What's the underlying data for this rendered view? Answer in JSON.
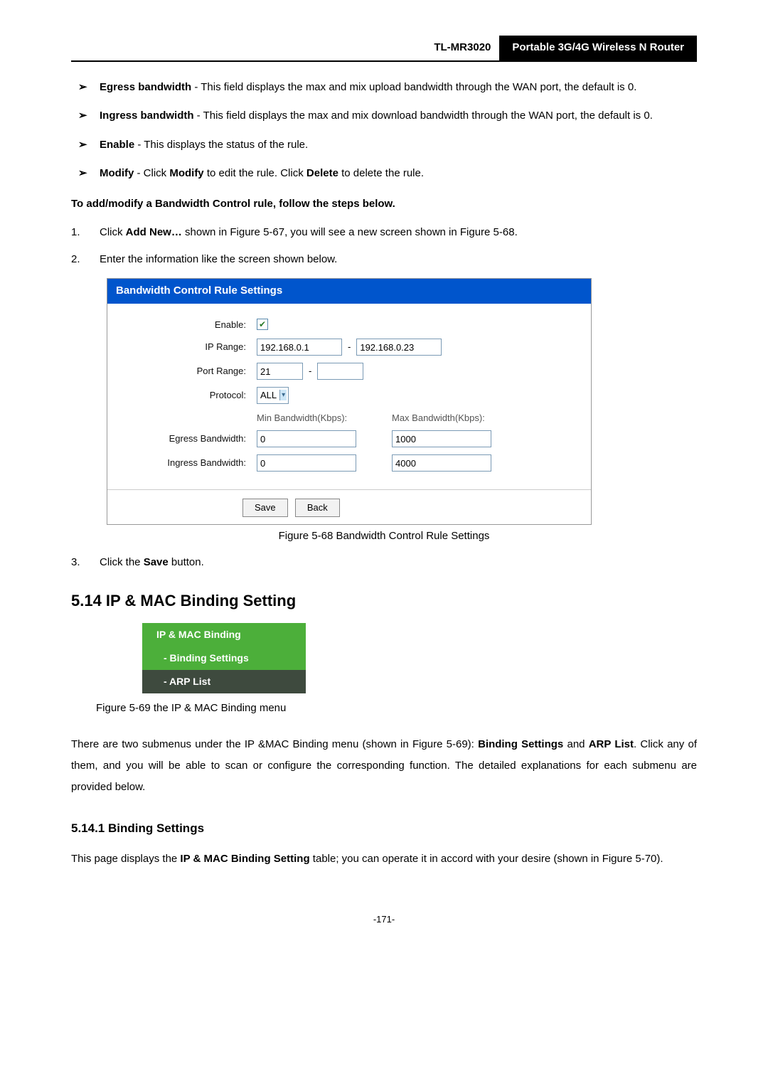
{
  "header": {
    "model": "TL-MR3020",
    "title": "Portable 3G/4G Wireless N Router"
  },
  "bullets": [
    {
      "term": "Egress bandwidth",
      "text": " - This field displays the max and mix upload bandwidth through the WAN port, the default is 0."
    },
    {
      "term": "Ingress bandwidth",
      "text": " - This field displays the max and mix download bandwidth through the WAN port, the default is 0."
    },
    {
      "term": "Enable",
      "text": " - This displays the status of the rule."
    },
    {
      "term": "Modify",
      "text_before": " - Click ",
      "bold1": "Modify",
      "text_mid": " to edit the rule. Click ",
      "bold2": "Delete",
      "text_after": " to delete the rule."
    }
  ],
  "instruction": "To add/modify a Bandwidth Control rule, follow the steps below.",
  "steps": {
    "s1_pre": "Click ",
    "s1_bold": "Add New…",
    "s1_post": " shown in Figure 5-67, you will see a new screen shown in Figure 5-68.",
    "s2": "Enter the information like the screen shown below.",
    "s3_pre": "Click the ",
    "s3_bold": "Save",
    "s3_post": " button."
  },
  "figure68": {
    "title": "Bandwidth Control Rule Settings",
    "labels": {
      "enable": "Enable:",
      "ip_range": "IP Range:",
      "port_range": "Port Range:",
      "protocol": "Protocol:",
      "min_bw": "Min Bandwidth(Kbps):",
      "max_bw": "Max Bandwidth(Kbps):",
      "egress": "Egress Bandwidth:",
      "ingress": "Ingress Bandwidth:"
    },
    "values": {
      "ip_start": "192.168.0.1",
      "ip_end": "192.168.0.23",
      "port_start": "21",
      "port_end": "",
      "protocol": "ALL",
      "egress_min": "0",
      "egress_max": "1000",
      "ingress_min": "0",
      "ingress_max": "4000"
    },
    "buttons": {
      "save": "Save",
      "back": "Back"
    },
    "caption": "Figure 5-68 Bandwidth Control Rule Settings"
  },
  "section": "5.14 IP & MAC Binding Setting",
  "menu": {
    "parent": "IP & MAC Binding",
    "item1": "- Binding Settings",
    "item2": "- ARP List"
  },
  "figure69_caption": "Figure 5-69 the IP & MAC Binding menu",
  "para_binding_1": "There are two submenus under the IP &MAC Binding menu (shown in Figure 5-69): ",
  "para_binding_bold1": "Binding Settings",
  "para_binding_mid": " and ",
  "para_binding_bold2": "ARP List",
  "para_binding_2": ". Click any of them, and you will be able to scan or configure the corresponding function. The detailed explanations for each submenu are provided below.",
  "subsection": "5.14.1  Binding Settings",
  "para_sub_1": "This page displays the ",
  "para_sub_bold": "IP & MAC Binding Setting",
  "para_sub_2": " table; you can operate it in accord with your desire (shown in Figure 5-70).",
  "page_number": "-171-"
}
